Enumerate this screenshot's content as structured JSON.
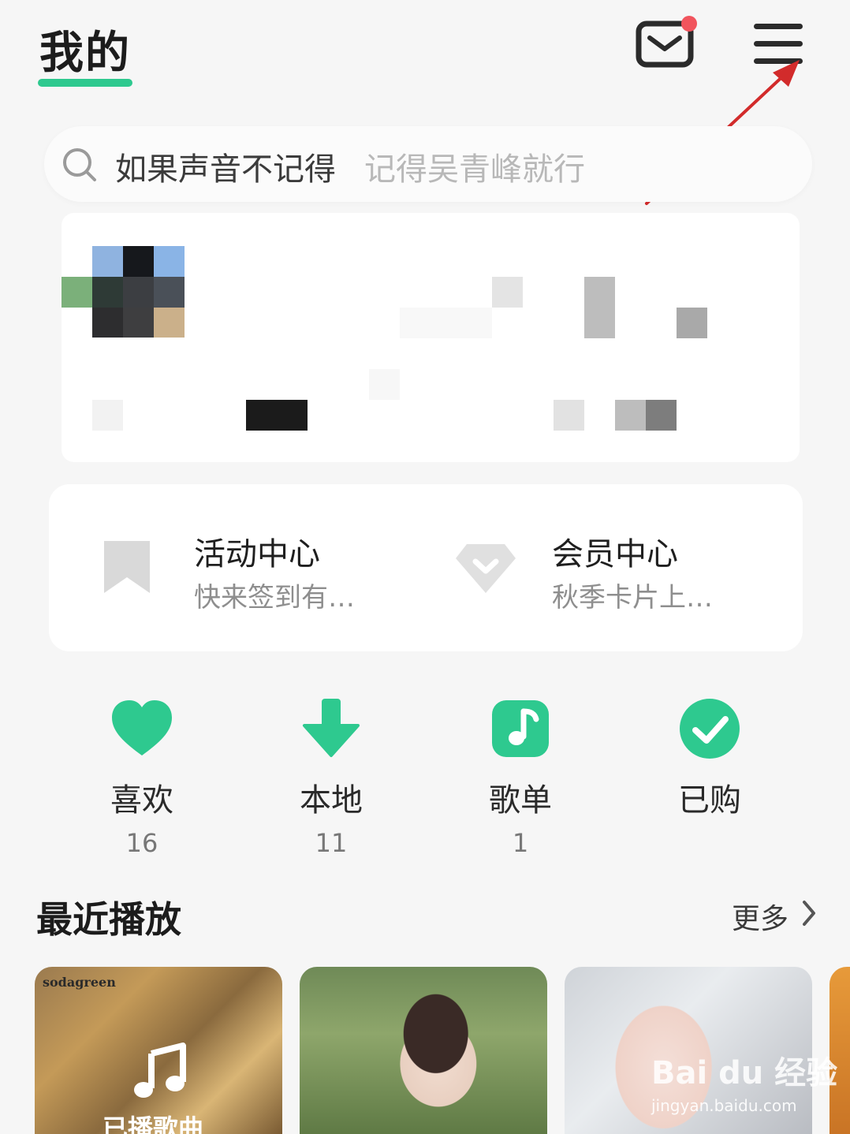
{
  "header": {
    "title": "我的",
    "accent_color": "#2ec98f",
    "mail_icon": "mail-icon",
    "menu_icon": "hamburger-menu-icon",
    "notification_color": "#f1545d"
  },
  "search": {
    "primary_text": "如果声音不记得",
    "hint_text": "记得吴青峰就行"
  },
  "activity": [
    {
      "title": "活动中心",
      "subtitle": "快来签到有…",
      "icon": "bookmark-icon"
    },
    {
      "title": "会员中心",
      "subtitle": "秋季卡片上…",
      "icon": "diamond-icon"
    }
  ],
  "quick_actions": [
    {
      "label": "喜欢",
      "count": "16",
      "icon": "heart-icon"
    },
    {
      "label": "本地",
      "count": "11",
      "icon": "download-icon"
    },
    {
      "label": "歌单",
      "count": "1",
      "icon": "music-note-icon"
    },
    {
      "label": "已购",
      "count": "",
      "icon": "check-circle-icon"
    }
  ],
  "recent": {
    "title": "最近播放",
    "more_label": "更多",
    "cards": [
      {
        "brand": "sodagreen",
        "label": "已播歌曲"
      },
      {
        "brand": "",
        "label": ""
      },
      {
        "brand": "",
        "label": ""
      }
    ]
  },
  "watermark": {
    "logo_text": "Bai du 经验",
    "url": "jingyan.baidu.com"
  }
}
